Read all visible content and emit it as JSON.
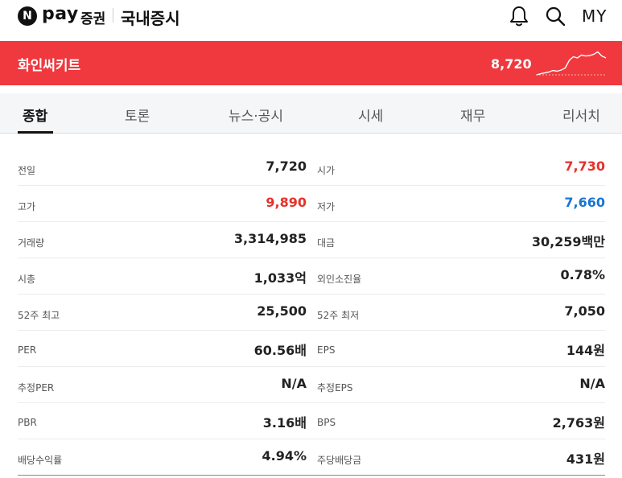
{
  "header": {
    "logo_n": "N",
    "logo_pay": "pay",
    "logo_sec": "증권",
    "title": "국내증시",
    "my_label": "MY",
    "icons": [
      "bell-icon",
      "search-icon"
    ]
  },
  "stock": {
    "name": "화인써키트",
    "price": "8,720",
    "sparkline_trend": [
      0.0,
      0.05,
      0.08,
      0.12,
      0.18,
      0.15,
      0.2,
      0.28,
      0.6,
      0.75,
      0.7,
      0.82,
      0.78,
      0.8,
      0.85,
      0.95,
      0.78,
      0.7
    ]
  },
  "tabs": [
    {
      "label": "종합",
      "active": true
    },
    {
      "label": "토론",
      "active": false
    },
    {
      "label": "뉴스·공시",
      "active": false
    },
    {
      "label": "시세",
      "active": false
    },
    {
      "label": "재무",
      "active": false
    },
    {
      "label": "리서치",
      "active": false
    }
  ],
  "rows": [
    {
      "left_label": "전일",
      "left_value": "7,720",
      "right_label": "시가",
      "right_value": "7,730",
      "left_color": "",
      "right_color": "up"
    },
    {
      "left_label": "고가",
      "left_value": "9,890",
      "right_label": "저가",
      "right_value": "7,660",
      "left_color": "up",
      "right_color": "down"
    },
    {
      "left_label": "거래량",
      "left_value": "3,314,985",
      "right_label": "대금",
      "right_value": "30,259백만",
      "left_color": "",
      "right_color": ""
    },
    {
      "left_label": "시총",
      "left_value": "1,033억",
      "right_label": "외인소진율",
      "right_value": "0.78%",
      "left_color": "",
      "right_color": ""
    },
    {
      "left_label": "52주 최고",
      "left_value": "25,500",
      "right_label": "52주 최저",
      "right_value": "7,050",
      "left_color": "",
      "right_color": ""
    },
    {
      "left_label": "PER",
      "left_value": "60.56배",
      "right_label": "EPS",
      "right_value": "144원",
      "left_color": "",
      "right_color": ""
    },
    {
      "left_label": "추정PER",
      "left_value": "N/A",
      "right_label": "추정EPS",
      "right_value": "N/A",
      "left_color": "",
      "right_color": ""
    },
    {
      "left_label": "PBR",
      "left_value": "3.16배",
      "right_label": "BPS",
      "right_value": "2,763원",
      "left_color": "",
      "right_color": ""
    },
    {
      "left_label": "배당수익률",
      "left_value": "4.94%",
      "right_label": "주당배당금",
      "right_value": "431원",
      "left_color": "",
      "right_color": ""
    }
  ],
  "colors": {
    "banner": "#f0393e",
    "up": "#e5322b",
    "down": "#1a74d6"
  }
}
